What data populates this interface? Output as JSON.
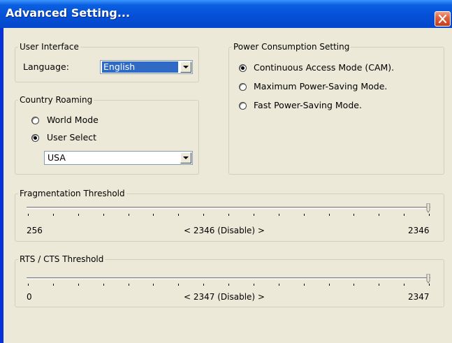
{
  "window": {
    "title": "Advanced Setting...",
    "colors": {
      "titlebar": "#0550d8",
      "client": "#ece9d8",
      "close": "#e06040"
    }
  },
  "user_interface": {
    "legend": "User Interface",
    "language_label": "Language:",
    "language_value": "English"
  },
  "country_roaming": {
    "legend": "Country Roaming",
    "options": [
      {
        "label": "World Mode",
        "selected": false
      },
      {
        "label": "User Select",
        "selected": true
      }
    ],
    "country_value": "USA"
  },
  "power": {
    "legend": "Power Consumption Setting",
    "options": [
      {
        "label": "Continuous Access Mode (CAM).",
        "selected": true
      },
      {
        "label": "Maximum Power-Saving Mode.",
        "selected": false
      },
      {
        "label": "Fast Power-Saving Mode.",
        "selected": false
      }
    ]
  },
  "fragmentation": {
    "legend": "Fragmentation Threshold",
    "min_label": "256",
    "current_label": "< 2346 (Disable) >",
    "max_label": "2346",
    "level": 1.0,
    "tick_count": 17
  },
  "rts_cts": {
    "legend": "RTS / CTS Threshold",
    "min_label": "0",
    "current_label": "< 2347 (Disable) >",
    "max_label": "2347",
    "level": 1.0,
    "tick_count": 17
  }
}
